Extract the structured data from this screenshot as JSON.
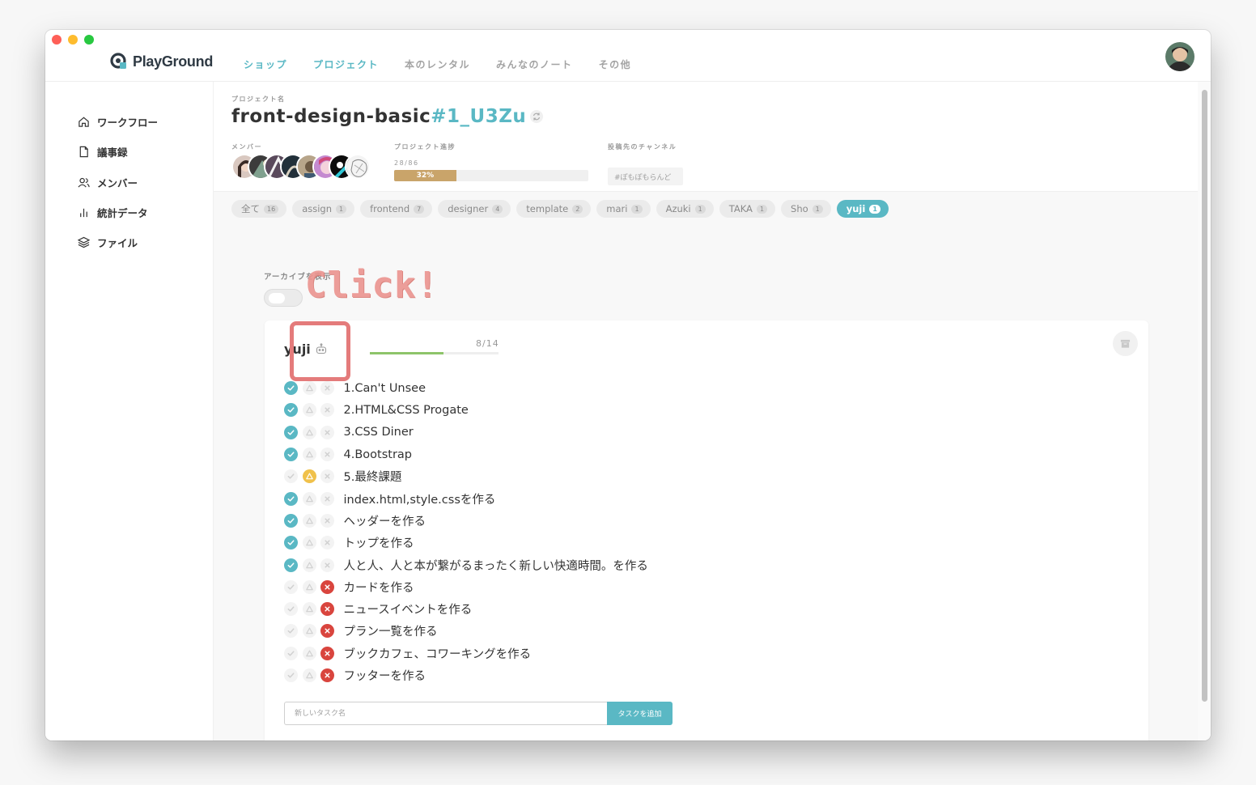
{
  "app": {
    "brand": "PlayGround",
    "nav": [
      "ショップ",
      "プロジェクト",
      "本のレンタル",
      "みんなのノート",
      "その他"
    ]
  },
  "sidebar": {
    "items": [
      {
        "label": "ワークフロー",
        "icon": "home-icon"
      },
      {
        "label": "議事録",
        "icon": "document-icon"
      },
      {
        "label": "メンバー",
        "icon": "users-icon"
      },
      {
        "label": "統計データ",
        "icon": "bar-chart-icon"
      },
      {
        "label": "ファイル",
        "icon": "layers-icon"
      }
    ]
  },
  "project": {
    "name_label": "プロジェクト名",
    "name": "front-design-basic",
    "hash": "#1_U3Zu",
    "members_label": "メンバー",
    "progress_label": "プロジェクト進捗",
    "progress_text": "28/86",
    "progress_percent_text": "32%",
    "progress_fraction": 0.32,
    "channel_label": "投稿先のチャンネル",
    "channel": "#ぽもぽもらんど"
  },
  "tags": [
    {
      "label": "全て",
      "count": "16"
    },
    {
      "label": "assign",
      "count": "1"
    },
    {
      "label": "frontend",
      "count": "7"
    },
    {
      "label": "designer",
      "count": "4"
    },
    {
      "label": "template",
      "count": "2"
    },
    {
      "label": "mari",
      "count": "1"
    },
    {
      "label": "Azuki",
      "count": "1"
    },
    {
      "label": "TAKA",
      "count": "1"
    },
    {
      "label": "Sho",
      "count": "1"
    },
    {
      "label": "yuji",
      "count": "1"
    }
  ],
  "archive": {
    "label": "アーカイブを表示"
  },
  "overlay": {
    "click_text": "Click!"
  },
  "card": {
    "user": "yuji",
    "progress_text": "8/14",
    "progress_fraction": 0.57,
    "tasks": [
      {
        "name": "1.Can't Unsee",
        "status": "ok"
      },
      {
        "name": "2.HTML&CSS Progate",
        "status": "ok"
      },
      {
        "name": "3.CSS Diner",
        "status": "ok"
      },
      {
        "name": "4.Bootstrap",
        "status": "ok"
      },
      {
        "name": "5.最終課題",
        "status": "warn"
      },
      {
        "name": "index.html,style.cssを作る",
        "status": "ok"
      },
      {
        "name": "ヘッダーを作る",
        "status": "ok"
      },
      {
        "name": "トップを作る",
        "status": "ok"
      },
      {
        "name": "人と人、人と本が繋がるまったく新しい快適時間。を作る",
        "status": "ok"
      },
      {
        "name": "カードを作る",
        "status": "ng"
      },
      {
        "name": "ニュースイベントを作る",
        "status": "ng"
      },
      {
        "name": "プラン一覧を作る",
        "status": "ng"
      },
      {
        "name": "ブックカフェ、コワーキングを作る",
        "status": "ng"
      },
      {
        "name": "フッターを作る",
        "status": "ng"
      }
    ],
    "new_task_placeholder": "新しいタスク名",
    "add_button": "タスクを追加"
  },
  "colors": {
    "accent": "#5ab8c4",
    "ok": "#5ab8c4",
    "warn": "#f0c14b",
    "ng": "#d9453e",
    "project_bar": "#c9a46a",
    "card_bar": "#8dc46a",
    "highlight": "#e47b7b"
  }
}
